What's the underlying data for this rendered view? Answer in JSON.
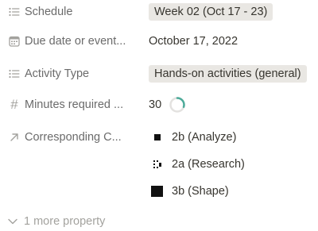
{
  "properties": [
    {
      "label": "Schedule",
      "icon": "list-icon",
      "value": "Week 02 (Oct 17 - 23)"
    },
    {
      "label": "Due date or event...",
      "icon": "calendar-icon",
      "value": "October 17, 2022"
    },
    {
      "label": "Activity Type",
      "icon": "list-icon",
      "value": "Hands-on activities (general)"
    },
    {
      "label": "Minutes required ...",
      "icon": "hash-icon",
      "value": "30",
      "progress": 0.3
    },
    {
      "label": "Corresponding C...",
      "icon": "arrow-up-right-icon"
    }
  ],
  "relations": [
    {
      "label": "2b (Analyze)",
      "icon": "small-black-square-icon"
    },
    {
      "label": "2a (Research)",
      "icon": "dotted-square-icon"
    },
    {
      "label": "3b (Shape)",
      "icon": "large-black-square-icon"
    }
  ],
  "footer": {
    "more_label": "1 more property",
    "icon": "chevron-down-icon"
  },
  "colors": {
    "label_text": "#6b6b6b",
    "icon_gray": "#a3a29e",
    "tag_bg": "#e9e7e3",
    "progress_green": "#4dab9a",
    "progress_track": "#e3e2e0"
  }
}
